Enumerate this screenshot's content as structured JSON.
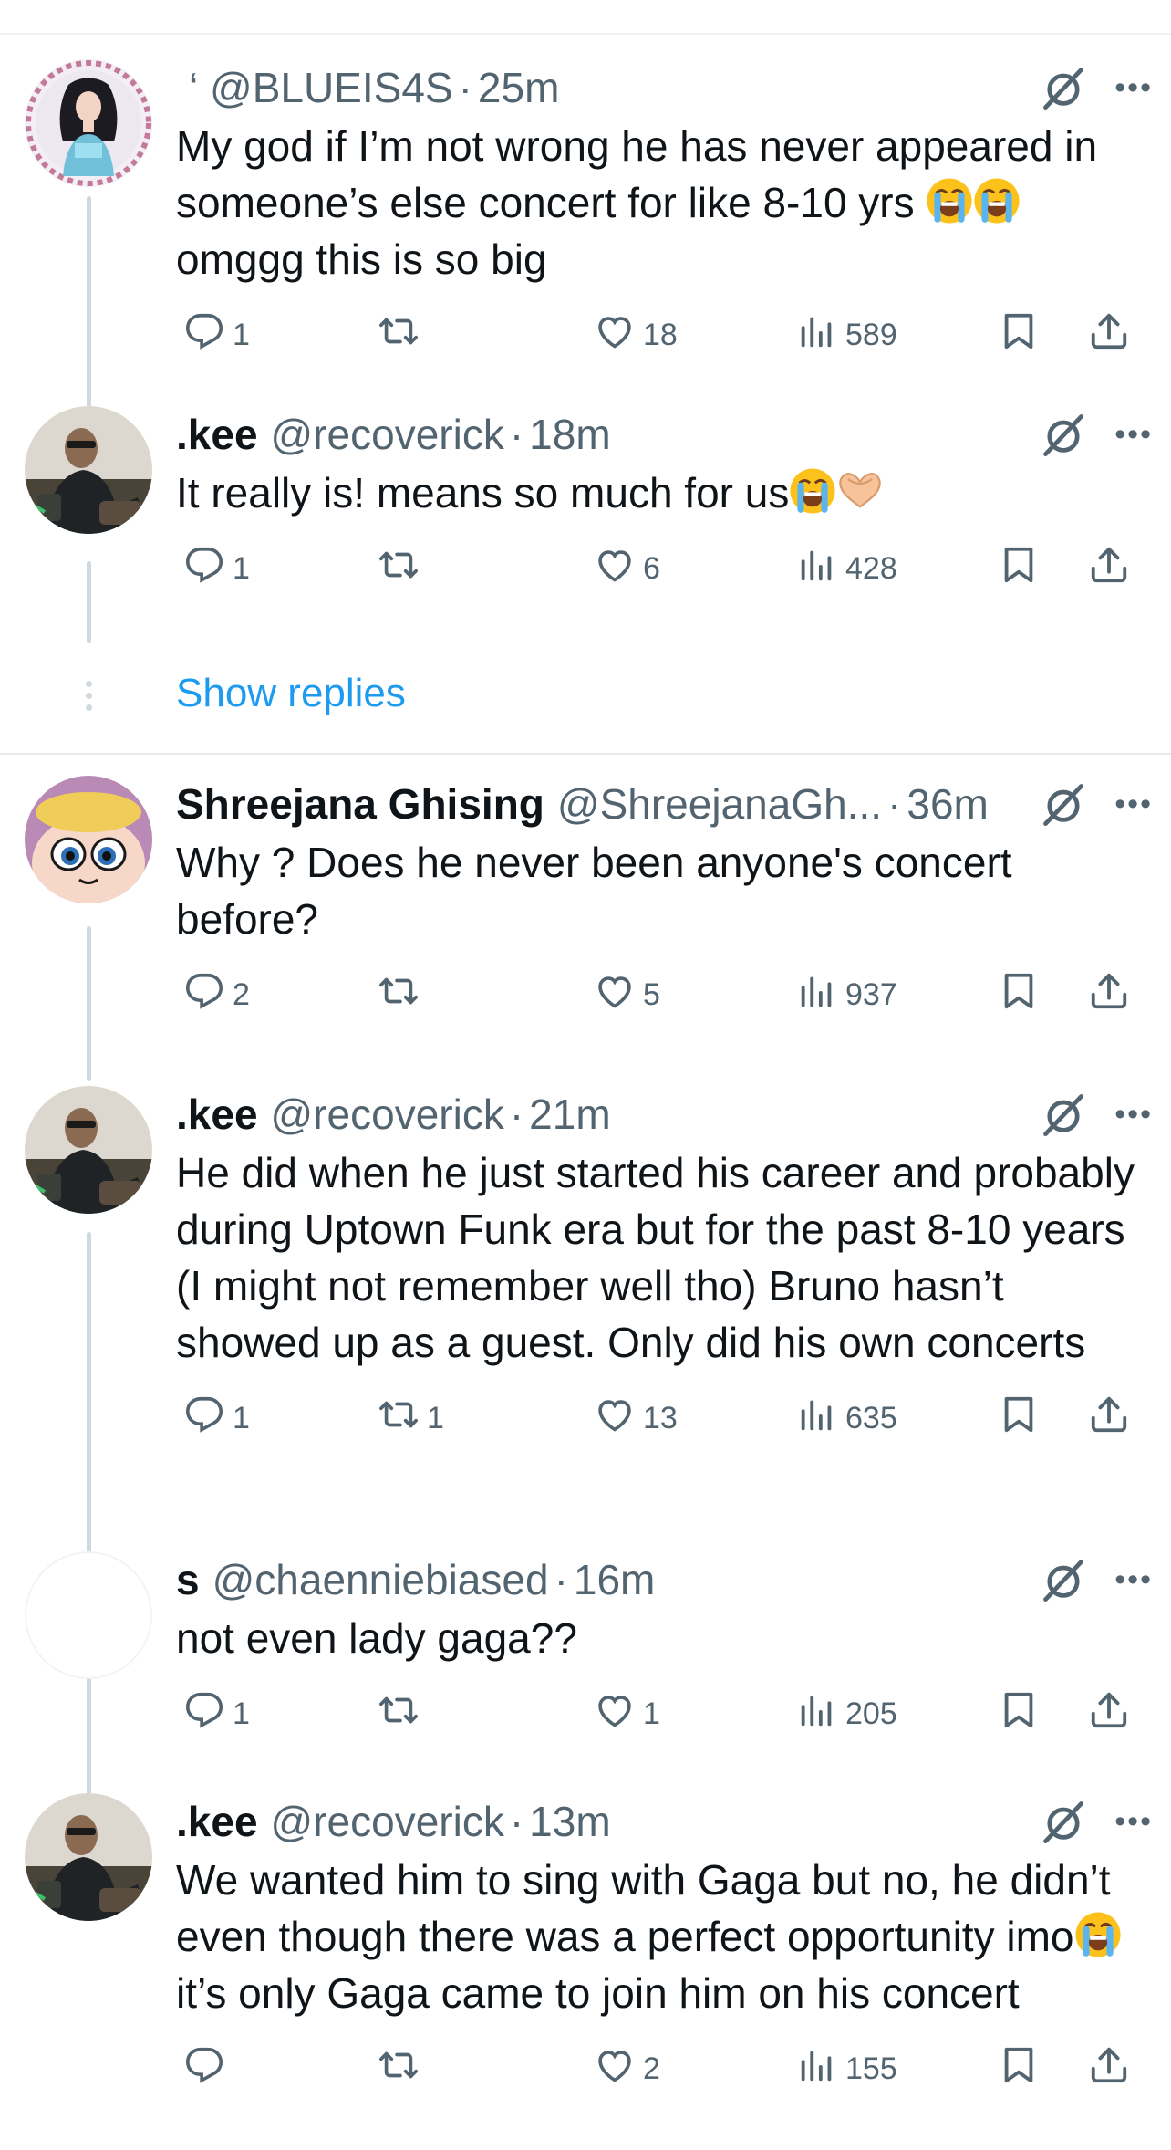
{
  "tweets": [
    {
      "name": "",
      "handle": "‘ @BLUEIS4S",
      "time": "25m",
      "text_parts": [
        "My god if I’m not wrong he has never appeared in someone’s else concert for like 8-10 yrs ",
        "",
        "\nomggg this is so big"
      ],
      "emoji": [
        "loudly-crying-face",
        "loudly-crying-face"
      ],
      "replies": "1",
      "reposts": "",
      "likes": "18",
      "views": "589",
      "avatar": "girl-in-blue-avatar"
    },
    {
      "name": ".kee",
      "handle": "@recoverick",
      "time": "18m",
      "text_parts": [
        "It really is! means so much for us",
        ""
      ],
      "emoji": [
        "loudly-crying-face",
        "heart-hands"
      ],
      "replies": "1",
      "reposts": "",
      "likes": "6",
      "views": "428",
      "avatar": "man-sunglasses-avatar"
    },
    {
      "name": "Shreejana Ghising",
      "handle": "@ShreejanaGh...",
      "time": "36m",
      "text_parts": [
        "Why ? Does he never been anyone's concert before?"
      ],
      "emoji": [],
      "replies": "2",
      "reposts": "",
      "likes": "5",
      "views": "937",
      "avatar": "powerpuff-girl-avatar"
    },
    {
      "name": ".kee",
      "handle": "@recoverick",
      "time": "21m",
      "text_parts": [
        "He did when he just started his career and probably during Uptown Funk era but for the past 8-10 years (I might not remember well tho) Bruno hasn’t showed up as a guest. Only did his own concerts"
      ],
      "emoji": [],
      "replies": "1",
      "reposts": "1",
      "likes": "13",
      "views": "635",
      "avatar": "man-sunglasses-avatar"
    },
    {
      "name": "s",
      "handle": "@chaenniebiased",
      "time": "16m",
      "text_parts": [
        "not even lady gaga??"
      ],
      "emoji": [],
      "replies": "1",
      "reposts": "",
      "likes": "1",
      "views": "205",
      "avatar": "blank-avatar"
    },
    {
      "name": ".kee",
      "handle": "@recoverick",
      "time": "13m",
      "text_parts": [
        "We wanted him to sing with Gaga but no, he didn’t even though there was a perfect opportunity imo",
        " it’s only Gaga came to join him on his concert"
      ],
      "emoji": [
        "loudly-crying-face"
      ],
      "replies": "",
      "reposts": "",
      "likes": "2",
      "views": "155",
      "avatar": "man-sunglasses-avatar"
    }
  ],
  "show_replies": "Show replies",
  "separator": "·",
  "icons": {
    "reply": "reply-icon",
    "repost": "repost-icon",
    "like": "heart-icon",
    "views": "views-icon",
    "bookmark": "bookmark-icon",
    "share": "share-icon",
    "grok": "grok-icon",
    "more": "more-icon"
  },
  "colors": {
    "link": "#1d9bf0",
    "muted": "#536471",
    "text": "#0f1419"
  }
}
